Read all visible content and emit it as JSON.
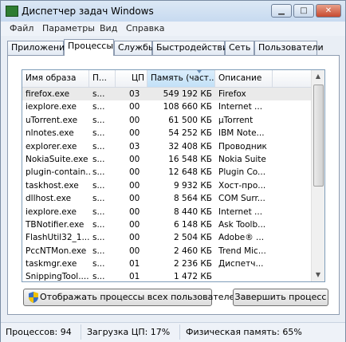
{
  "window": {
    "title": "Диспетчер задач Windows",
    "icon": "task-manager-icon"
  },
  "controls": {
    "minimize": "▁",
    "maximize": "□",
    "close": "✕"
  },
  "menu": [
    "Файл",
    "Параметры",
    "Вид",
    "Справка"
  ],
  "tabs": [
    "Приложения",
    "Процессы",
    "Службы",
    "Быстродействие",
    "Сеть",
    "Пользователи"
  ],
  "active_tab": "Процессы",
  "columns": [
    "Имя образа",
    "П...",
    "ЦП",
    "Память (част...",
    "Описание"
  ],
  "rows": [
    [
      "firefox.exe",
      "s...",
      "03",
      "549 192 КБ",
      "Firefox"
    ],
    [
      "iexplore.exe",
      "s...",
      "00",
      "108 660 КБ",
      "Internet ..."
    ],
    [
      "uTorrent.exe",
      "s...",
      "00",
      "61 500 КБ",
      "µTorrent"
    ],
    [
      "nlnotes.exe",
      "s...",
      "00",
      "54 252 КБ",
      "IBM Note..."
    ],
    [
      "explorer.exe",
      "s...",
      "03",
      "32 408 КБ",
      "Проводник"
    ],
    [
      "NokiaSuite.exe",
      "s...",
      "00",
      "16 548 КБ",
      "Nokia Suite"
    ],
    [
      "plugin-contain...",
      "s...",
      "00",
      "12 648 КБ",
      "Plugin Co..."
    ],
    [
      "taskhost.exe",
      "s...",
      "00",
      "9 932 КБ",
      "Хост-про..."
    ],
    [
      "dllhost.exe",
      "s...",
      "00",
      "8 564 КБ",
      "COM Surr..."
    ],
    [
      "iexplore.exe",
      "s...",
      "00",
      "8 440 КБ",
      "Internet ..."
    ],
    [
      "TBNotifier.exe",
      "s...",
      "00",
      "6 148 КБ",
      "Ask Toolb..."
    ],
    [
      "FlashUtil32_1...",
      "s...",
      "00",
      "2 504 КБ",
      "Adobe® ..."
    ],
    [
      "PccNTMon.exe",
      "s...",
      "00",
      "2 460 КБ",
      "Trend Mic..."
    ],
    [
      "taskmgr.exe",
      "s...",
      "01",
      "2 236 КБ",
      "Диспетч..."
    ],
    [
      "SnippingTool....",
      "s...",
      "01",
      "1 472 КБ",
      ""
    ]
  ],
  "selected_row": 0,
  "buttons": {
    "show_all": "Отображать процессы всех пользователей",
    "end_process": "Завершить процесс"
  },
  "status": {
    "processes": "Процессов: 94",
    "cpu": "Загрузка ЦП: 17%",
    "memory": "Физическая память: 65%"
  }
}
